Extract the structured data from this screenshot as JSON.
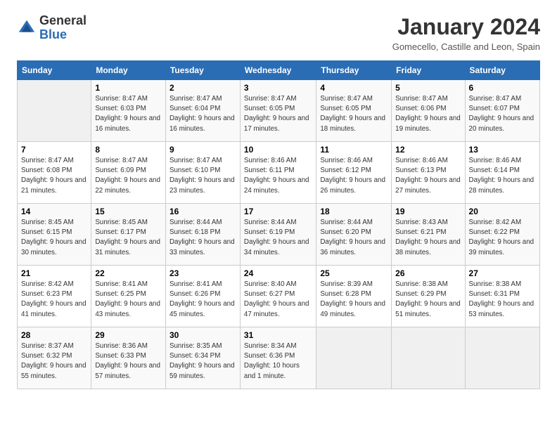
{
  "logo": {
    "text_general": "General",
    "text_blue": "Blue"
  },
  "title": "January 2024",
  "location": "Gomecello, Castille and Leon, Spain",
  "days_of_week": [
    "Sunday",
    "Monday",
    "Tuesday",
    "Wednesday",
    "Thursday",
    "Friday",
    "Saturday"
  ],
  "weeks": [
    [
      {
        "day": "",
        "empty": true
      },
      {
        "day": "1",
        "sunrise": "Sunrise: 8:47 AM",
        "sunset": "Sunset: 6:03 PM",
        "daylight": "Daylight: 9 hours and 16 minutes."
      },
      {
        "day": "2",
        "sunrise": "Sunrise: 8:47 AM",
        "sunset": "Sunset: 6:04 PM",
        "daylight": "Daylight: 9 hours and 16 minutes."
      },
      {
        "day": "3",
        "sunrise": "Sunrise: 8:47 AM",
        "sunset": "Sunset: 6:05 PM",
        "daylight": "Daylight: 9 hours and 17 minutes."
      },
      {
        "day": "4",
        "sunrise": "Sunrise: 8:47 AM",
        "sunset": "Sunset: 6:05 PM",
        "daylight": "Daylight: 9 hours and 18 minutes."
      },
      {
        "day": "5",
        "sunrise": "Sunrise: 8:47 AM",
        "sunset": "Sunset: 6:06 PM",
        "daylight": "Daylight: 9 hours and 19 minutes."
      },
      {
        "day": "6",
        "sunrise": "Sunrise: 8:47 AM",
        "sunset": "Sunset: 6:07 PM",
        "daylight": "Daylight: 9 hours and 20 minutes."
      }
    ],
    [
      {
        "day": "7",
        "sunrise": "Sunrise: 8:47 AM",
        "sunset": "Sunset: 6:08 PM",
        "daylight": "Daylight: 9 hours and 21 minutes."
      },
      {
        "day": "8",
        "sunrise": "Sunrise: 8:47 AM",
        "sunset": "Sunset: 6:09 PM",
        "daylight": "Daylight: 9 hours and 22 minutes."
      },
      {
        "day": "9",
        "sunrise": "Sunrise: 8:47 AM",
        "sunset": "Sunset: 6:10 PM",
        "daylight": "Daylight: 9 hours and 23 minutes."
      },
      {
        "day": "10",
        "sunrise": "Sunrise: 8:46 AM",
        "sunset": "Sunset: 6:11 PM",
        "daylight": "Daylight: 9 hours and 24 minutes."
      },
      {
        "day": "11",
        "sunrise": "Sunrise: 8:46 AM",
        "sunset": "Sunset: 6:12 PM",
        "daylight": "Daylight: 9 hours and 26 minutes."
      },
      {
        "day": "12",
        "sunrise": "Sunrise: 8:46 AM",
        "sunset": "Sunset: 6:13 PM",
        "daylight": "Daylight: 9 hours and 27 minutes."
      },
      {
        "day": "13",
        "sunrise": "Sunrise: 8:46 AM",
        "sunset": "Sunset: 6:14 PM",
        "daylight": "Daylight: 9 hours and 28 minutes."
      }
    ],
    [
      {
        "day": "14",
        "sunrise": "Sunrise: 8:45 AM",
        "sunset": "Sunset: 6:15 PM",
        "daylight": "Daylight: 9 hours and 30 minutes."
      },
      {
        "day": "15",
        "sunrise": "Sunrise: 8:45 AM",
        "sunset": "Sunset: 6:17 PM",
        "daylight": "Daylight: 9 hours and 31 minutes."
      },
      {
        "day": "16",
        "sunrise": "Sunrise: 8:44 AM",
        "sunset": "Sunset: 6:18 PM",
        "daylight": "Daylight: 9 hours and 33 minutes."
      },
      {
        "day": "17",
        "sunrise": "Sunrise: 8:44 AM",
        "sunset": "Sunset: 6:19 PM",
        "daylight": "Daylight: 9 hours and 34 minutes."
      },
      {
        "day": "18",
        "sunrise": "Sunrise: 8:44 AM",
        "sunset": "Sunset: 6:20 PM",
        "daylight": "Daylight: 9 hours and 36 minutes."
      },
      {
        "day": "19",
        "sunrise": "Sunrise: 8:43 AM",
        "sunset": "Sunset: 6:21 PM",
        "daylight": "Daylight: 9 hours and 38 minutes."
      },
      {
        "day": "20",
        "sunrise": "Sunrise: 8:42 AM",
        "sunset": "Sunset: 6:22 PM",
        "daylight": "Daylight: 9 hours and 39 minutes."
      }
    ],
    [
      {
        "day": "21",
        "sunrise": "Sunrise: 8:42 AM",
        "sunset": "Sunset: 6:23 PM",
        "daylight": "Daylight: 9 hours and 41 minutes."
      },
      {
        "day": "22",
        "sunrise": "Sunrise: 8:41 AM",
        "sunset": "Sunset: 6:25 PM",
        "daylight": "Daylight: 9 hours and 43 minutes."
      },
      {
        "day": "23",
        "sunrise": "Sunrise: 8:41 AM",
        "sunset": "Sunset: 6:26 PM",
        "daylight": "Daylight: 9 hours and 45 minutes."
      },
      {
        "day": "24",
        "sunrise": "Sunrise: 8:40 AM",
        "sunset": "Sunset: 6:27 PM",
        "daylight": "Daylight: 9 hours and 47 minutes."
      },
      {
        "day": "25",
        "sunrise": "Sunrise: 8:39 AM",
        "sunset": "Sunset: 6:28 PM",
        "daylight": "Daylight: 9 hours and 49 minutes."
      },
      {
        "day": "26",
        "sunrise": "Sunrise: 8:38 AM",
        "sunset": "Sunset: 6:29 PM",
        "daylight": "Daylight: 9 hours and 51 minutes."
      },
      {
        "day": "27",
        "sunrise": "Sunrise: 8:38 AM",
        "sunset": "Sunset: 6:31 PM",
        "daylight": "Daylight: 9 hours and 53 minutes."
      }
    ],
    [
      {
        "day": "28",
        "sunrise": "Sunrise: 8:37 AM",
        "sunset": "Sunset: 6:32 PM",
        "daylight": "Daylight: 9 hours and 55 minutes."
      },
      {
        "day": "29",
        "sunrise": "Sunrise: 8:36 AM",
        "sunset": "Sunset: 6:33 PM",
        "daylight": "Daylight: 9 hours and 57 minutes."
      },
      {
        "day": "30",
        "sunrise": "Sunrise: 8:35 AM",
        "sunset": "Sunset: 6:34 PM",
        "daylight": "Daylight: 9 hours and 59 minutes."
      },
      {
        "day": "31",
        "sunrise": "Sunrise: 8:34 AM",
        "sunset": "Sunset: 6:36 PM",
        "daylight": "Daylight: 10 hours and 1 minute."
      },
      {
        "day": "",
        "empty": true
      },
      {
        "day": "",
        "empty": true
      },
      {
        "day": "",
        "empty": true
      }
    ]
  ]
}
